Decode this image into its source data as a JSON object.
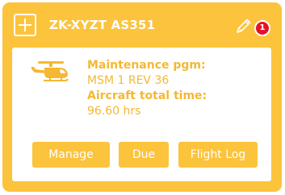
{
  "aircraft": {
    "title": "ZK-XYZT AS351",
    "notification_count": "1",
    "icon": "helicopter-icon"
  },
  "details": {
    "maintenance_label": "Maintenance pgm:",
    "maintenance_value": "MSM 1 REV 36",
    "total_time_label": "Aircraft total time:",
    "total_time_value": "96.60 hrs"
  },
  "actions": {
    "manage": "Manage",
    "due": "Due",
    "flight_log": "Flight Log"
  },
  "colors": {
    "card": "#fcc33c",
    "accent_text": "#f5b832",
    "badge": "#e3132a",
    "panel": "#ffffff"
  }
}
